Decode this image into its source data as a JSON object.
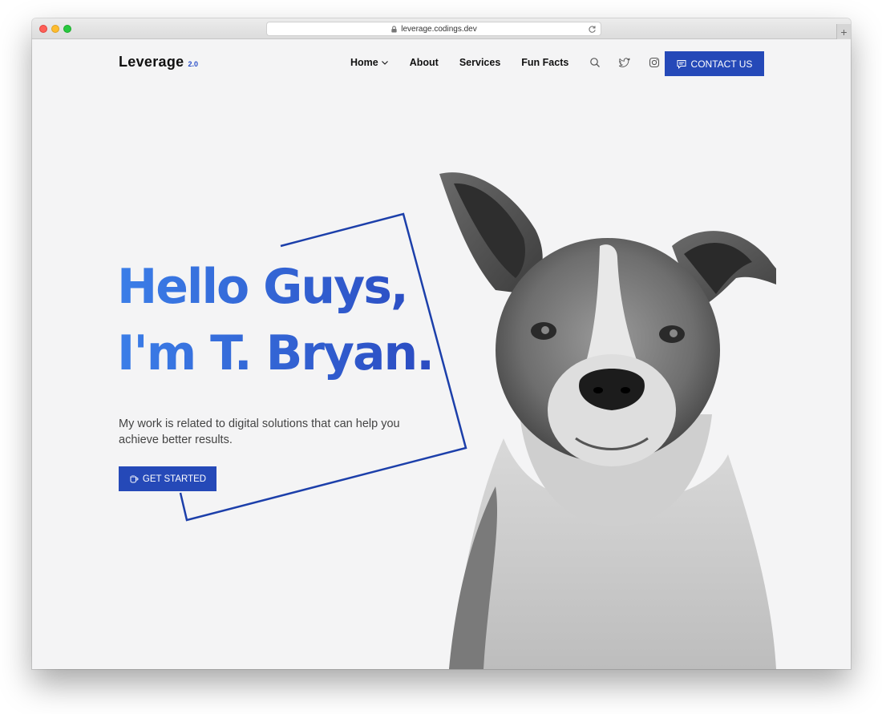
{
  "browser": {
    "url": "leverage.codings.dev",
    "newtab_label": "+"
  },
  "header": {
    "logo": "Leverage",
    "logo_version": "2.0",
    "nav": [
      {
        "label": "Home",
        "has_dropdown": true
      },
      {
        "label": "About"
      },
      {
        "label": "Services"
      },
      {
        "label": "Fun Facts"
      }
    ],
    "icons": [
      "search-icon",
      "twitter-icon",
      "instagram-icon"
    ],
    "contact_label": "CONTACT US"
  },
  "hero": {
    "title_line1": "Hello Guys,",
    "title_line2": "I'm T. Bryan.",
    "description": "My work is related to digital solutions that can help you achieve better results.",
    "cta_label": "GET STARTED"
  },
  "colors": {
    "accent": "#2549b8",
    "title_gradient_start": "#3b7ee8",
    "title_gradient_end": "#2b4bc1",
    "background": "#f4f4f5"
  }
}
